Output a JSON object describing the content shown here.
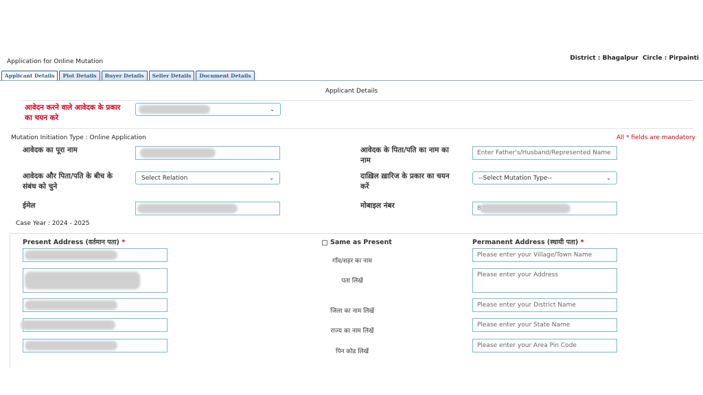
{
  "header": {
    "app_title": "Application for Online Mutation",
    "district_info": "District : Bhagalpur  Circle : Pirpainti"
  },
  "tabs": [
    {
      "label": "Applicant Details",
      "active": true
    },
    {
      "label": "Plot Details",
      "active": false
    },
    {
      "label": "Buyer Details",
      "active": false
    },
    {
      "label": "Seller Details",
      "active": false
    },
    {
      "label": "Document Details",
      "active": false
    }
  ],
  "section_title": "Applicant Details",
  "applicant_type": {
    "label": "आवेदन करने वाले आवेदक के प्रकार का चयन करे"
  },
  "mutation_initiation": "Mutation Initiation Type : Online Application",
  "mandatory_note": "All * fields are mandatory",
  "form": {
    "full_name_label": "आवेदक का पूरा नाम",
    "father_name_label": "आवेदक के पिता/पति का नाम का नाम",
    "father_name_placeholder": "Enter Father's/Husband/Represented Name",
    "relation_label": "आवेदक और पिता/पति के बीच के संबंध को चुने",
    "relation_value": "Select Relation",
    "mutation_type_label": "दाख़िल ख़ारिज के प्रकार का चयन करें",
    "mutation_type_value": "--Select Mutation Type--",
    "email_label": "ईमेल",
    "mobile_label": "मोबाइल नंबर",
    "mobile_prefix": "8",
    "case_year": "Case Year : 2024 - 2025"
  },
  "address": {
    "present_label": "Present Address (वर्तमान पता)",
    "permanent_label": "Permanent Address (स्थायी पता)",
    "same_as_present": "Same as Present",
    "required_mark": "*",
    "rows": [
      {
        "label": "गाँव/शहर का नाम",
        "placeholder": "Please enter your Village/Town Name"
      },
      {
        "label": "पता लिखें",
        "placeholder": "Please enter your Address"
      },
      {
        "label": "जिला का नाम लिखें",
        "placeholder": "Please enter your District Name"
      },
      {
        "label": "राज्य का नाम लिखें",
        "placeholder": "Please enter your State Name"
      },
      {
        "label": "पिन कोड लिखें",
        "placeholder": "Please enter your Area Pin Code"
      }
    ]
  },
  "icons": {
    "dropdown": "chevron-down-icon",
    "checkbox": "checkbox-icon"
  },
  "colors": {
    "accent": "#2a5a8c",
    "required": "#d0021b",
    "field_border": "#7ab8cc"
  }
}
